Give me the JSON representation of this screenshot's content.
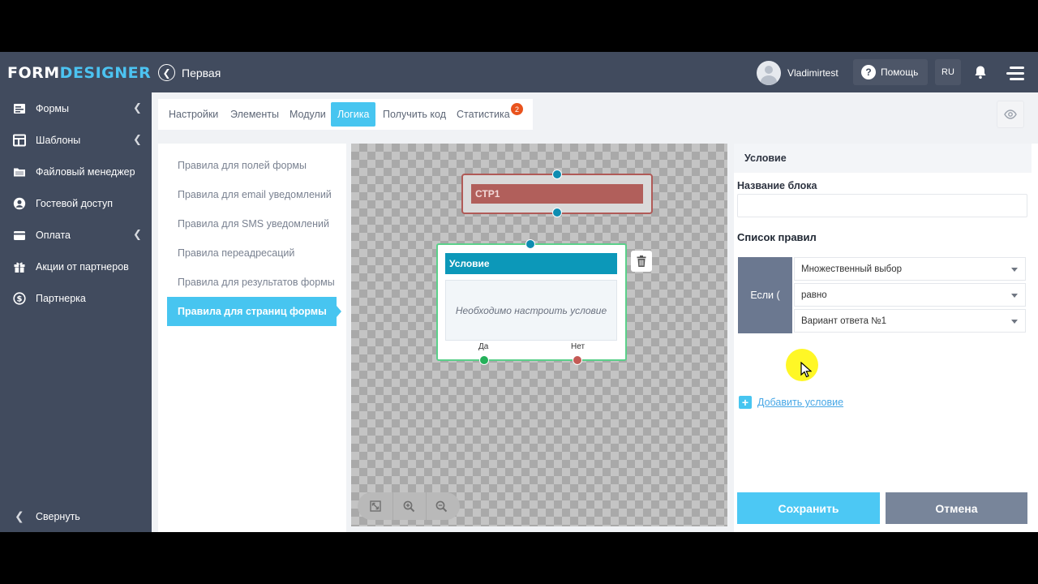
{
  "header": {
    "logo_part1": "FORM",
    "logo_part2": "DESIGNER",
    "back_icon": "chevron-left-icon",
    "page_name": "Первая",
    "username": "Vladimirtest",
    "help_label": "Помощь",
    "lang": "RU"
  },
  "sidebar": {
    "items": [
      {
        "label": "Формы",
        "icon": "forms-icon",
        "has_arrow": true
      },
      {
        "label": "Шаблоны",
        "icon": "templates-icon",
        "has_arrow": true
      },
      {
        "label": "Файловый менеджер",
        "icon": "folder-icon",
        "has_arrow": false
      },
      {
        "label": "Гостевой доступ",
        "icon": "user-icon",
        "has_arrow": false
      },
      {
        "label": "Оплата",
        "icon": "wallet-icon",
        "has_arrow": true
      },
      {
        "label": "Акции от партнеров",
        "icon": "gift-icon",
        "has_arrow": false
      },
      {
        "label": "Партнерка",
        "icon": "dollar-icon",
        "has_arrow": false
      }
    ],
    "collapse_label": "Свернуть"
  },
  "tabs": {
    "items": [
      "Настройки",
      "Элементы",
      "Модули",
      "Логика",
      "Получить код",
      "Статистика"
    ],
    "active": "Логика",
    "stats_badge": "2"
  },
  "rules": {
    "items": [
      "Правила для полей формы",
      "Правила для email уведомлений",
      "Правила для SMS уведомлений",
      "Правила переадресаций",
      "Правила для результатов формы",
      "Правила для страниц формы"
    ],
    "active_index": 5
  },
  "canvas": {
    "page_node_label": "СТР1",
    "condition_title": "Условие",
    "condition_body": "Необходимо настроить условие",
    "yes_label": "Да",
    "no_label": "Нет"
  },
  "panel": {
    "header": "Условие",
    "block_name_label": "Название блока",
    "block_name_value": "",
    "rules_title": "Список правил",
    "if_label": "Если (",
    "field_select": "Множественный выбор",
    "operator_select": "равно",
    "value_select": "Вариант ответа №1",
    "add_condition": "Добавить условие",
    "save_label": "Сохранить",
    "cancel_label": "Отмена"
  },
  "colors": {
    "topbar": "#414b5e",
    "accent": "#47c5f0",
    "logo_accent": "#4cc3f1",
    "page_node": "#b15f5b",
    "condition_header": "#0c98b9",
    "badge": "#e9531d",
    "cancel": "#78859a"
  }
}
